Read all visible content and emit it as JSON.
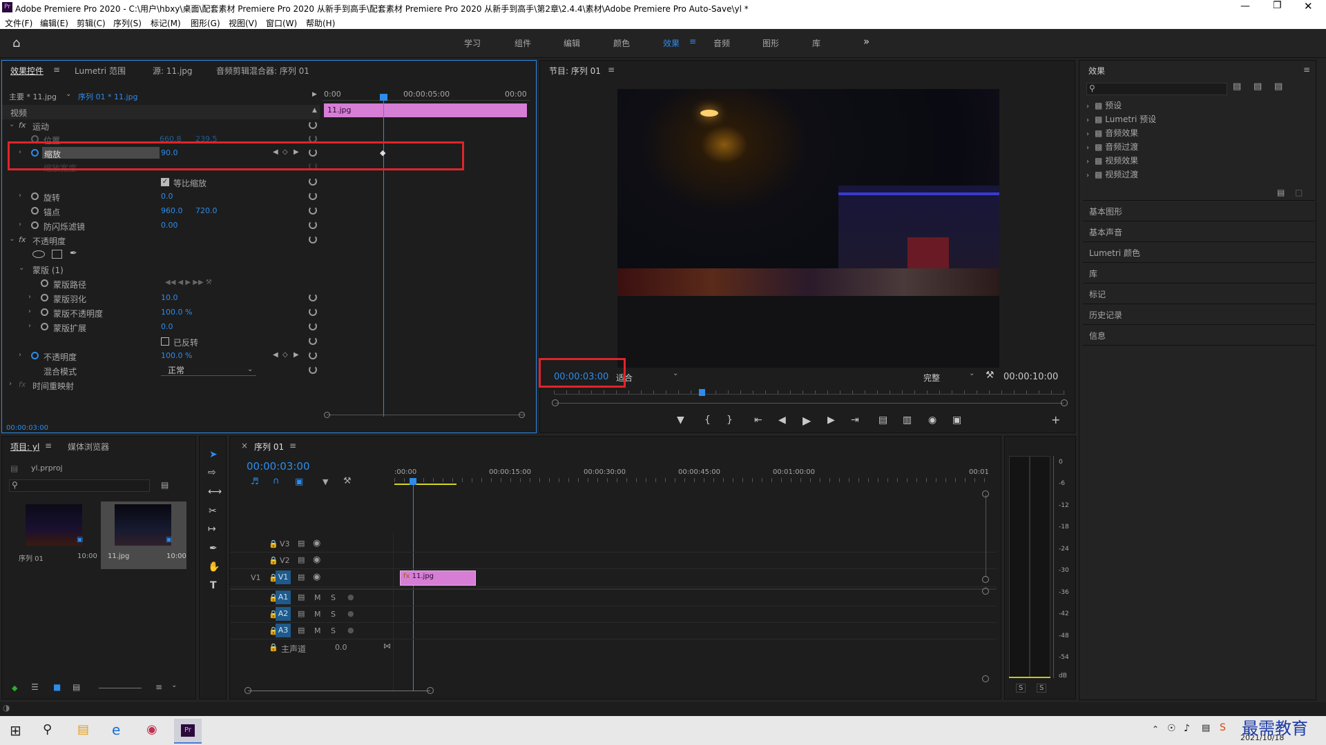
{
  "window": {
    "title": "Adobe Premiere Pro 2020 - C:\\用户\\hbxy\\桌面\\配套素材 Premiere Pro 2020 从新手到高手\\配套素材 Premiere Pro 2020 从新手到高手\\第2章\\2.4.4\\素材\\Adobe Premiere Pro Auto-Save\\yl *",
    "app_icon": "Pr"
  },
  "menu": [
    "文件(F)",
    "编辑(E)",
    "剪辑(C)",
    "序列(S)",
    "标记(M)",
    "图形(G)",
    "视图(V)",
    "窗口(W)",
    "帮助(H)"
  ],
  "workspaces": [
    "学习",
    "组件",
    "编辑",
    "颜色",
    "效果",
    "音频",
    "图形",
    "库"
  ],
  "active_workspace": "效果",
  "effect_controls": {
    "tabs": [
      "效果控件",
      "Lumetri 范围",
      "源: 11.jpg",
      "音频剪辑混合器: 序列 01"
    ],
    "master": "主要 * 11.jpg",
    "sequence": "序列 01 * 11.jpg",
    "section_video": "视频",
    "motion": "运动",
    "position_label": "位置",
    "position_x": "660.8",
    "position_y": "239.5",
    "scale_label": "缩放",
    "scale_value": "90.0",
    "scale_width_label": "缩放宽度",
    "uniform_label": "等比缩放",
    "rotation_label": "旋转",
    "rotation_value": "0.0",
    "anchor_label": "锚点",
    "anchor_x": "960.0",
    "anchor_y": "720.0",
    "flicker_label": "防闪烁滤镜",
    "flicker_value": "0.00",
    "opacity_group": "不透明度",
    "mask_label": "蒙版 (1)",
    "mask_path": "蒙版路径",
    "mask_feather": "蒙版羽化",
    "mask_feather_value": "10.0",
    "mask_opacity": "蒙版不透明度",
    "mask_opacity_value": "100.0 %",
    "mask_expansion": "蒙版扩展",
    "mask_expansion_value": "0.0",
    "inverted_label": "已反转",
    "opacity_label": "不透明度",
    "opacity_value": "100.0 %",
    "blend_label": "混合模式",
    "blend_value": "正常",
    "time_remap": "时间重映射",
    "timecode": "00:00:03:00",
    "ruler": [
      "0:00",
      "00:00:05:00",
      "00:00"
    ],
    "clip_name": "11.jpg"
  },
  "program": {
    "title": "节目: 序列 01",
    "timecode": "00:00:03:00",
    "fit": "适合",
    "quality": "完整",
    "duration": "00:00:10:00"
  },
  "effects_panel": {
    "title": "效果",
    "tree": [
      "预设",
      "Lumetri 预设",
      "音频效果",
      "音频过渡",
      "视频效果",
      "视频过渡"
    ],
    "panels": [
      "基本图形",
      "基本声音",
      "Lumetri 颜色",
      "库",
      "标记",
      "历史记录",
      "信息"
    ]
  },
  "project": {
    "tabs": [
      "项目: yl",
      "媒体浏览器"
    ],
    "file": "yl.prproj",
    "items": [
      {
        "name": "序列 01",
        "duration": "10:00"
      },
      {
        "name": "11.jpg",
        "duration": "10:00"
      }
    ]
  },
  "timeline": {
    "tab": "序列 01",
    "timecode": "00:00:03:00",
    "ruler": [
      ":00:00",
      "00:00:15:00",
      "00:00:30:00",
      "00:00:45:00",
      "00:01:00:00",
      "00:01"
    ],
    "tracks": [
      "V3",
      "V2",
      "V1",
      "A1",
      "A2",
      "A3"
    ],
    "source_v": "V1",
    "master": "主声道",
    "master_value": "0.0",
    "clip": "11.jpg"
  },
  "vu": {
    "ticks": [
      "0",
      "-6",
      "-12",
      "-18",
      "-24",
      "-30",
      "-36",
      "-42",
      "-48",
      "-54",
      "dB"
    ],
    "solo": [
      "S",
      "S"
    ]
  },
  "taskbar": {
    "date": "2021/10/18",
    "watermark": "最需教育"
  }
}
